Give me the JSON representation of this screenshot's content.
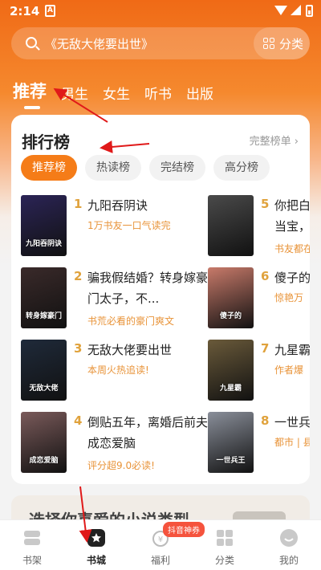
{
  "status_bar": {
    "time": "2:14",
    "sim_label": "A"
  },
  "search": {
    "placeholder": "《无敌大佬要出世》",
    "category_label": "分类",
    "search_icon": "search-icon",
    "grid_icon": "grid-icon"
  },
  "tabs": [
    {
      "label": "推荐",
      "active": true
    },
    {
      "label": "男生"
    },
    {
      "label": "女生"
    },
    {
      "label": "听书"
    },
    {
      "label": "出版"
    }
  ],
  "ranking": {
    "title": "排行榜",
    "more_label": "完整榜单 ›",
    "chips": [
      {
        "label": "推荐榜",
        "active": true
      },
      {
        "label": "热读榜"
      },
      {
        "label": "完结榜"
      },
      {
        "label": "高分榜"
      }
    ],
    "books": [
      {
        "rank": "1",
        "title": "九阳吞阴诀",
        "desc": "1万书友一口气读完",
        "cover_text": "九阳吞阴诀",
        "cover_color": "#2b2456"
      },
      {
        "rank": "2",
        "title": "骗我假结婚？转身嫁豪门太子，不...",
        "desc": "书荒必看的豪门爽文",
        "cover_text": "转身嫁豪门",
        "cover_color": "#3a2a2a"
      },
      {
        "rank": "3",
        "title": "无敌大佬要出世",
        "desc": "本周火热追读!",
        "cover_text": "无敌大佬",
        "cover_color": "#1f2a3a"
      },
      {
        "rank": "4",
        "title": "倒贴五年，离婚后前夫成恋爱脑",
        "desc": "评分超9.0必读!",
        "cover_text": "成恋爱脑",
        "cover_color": "#7a5a5a"
      },
      {
        "rank": "5",
        "title": "你把白月光当宝，我...",
        "desc": "书友都在",
        "cover_text": "",
        "cover_color": "#4a4a4a"
      },
      {
        "rank": "6",
        "title": "傻子的...",
        "desc": "惊艳万",
        "cover_text": "傻子的",
        "cover_color": "#c87a6a"
      },
      {
        "rank": "7",
        "title": "九星霸...",
        "desc": "作者爆",
        "cover_text": "九星霸",
        "cover_color": "#6a5a3a"
      },
      {
        "rank": "8",
        "title": "一世兵...",
        "desc": "都市 | 县",
        "cover_text": "一世兵王",
        "cover_color": "#8a8f9a"
      }
    ]
  },
  "promo": {
    "text": "选择你喜爱的小说类型"
  },
  "nav": [
    {
      "label": "书架",
      "icon": "bookshelf-icon"
    },
    {
      "label": "书城",
      "icon": "bookstore-icon",
      "active": true
    },
    {
      "label": "福利",
      "icon": "gift-icon"
    },
    {
      "label": "分类",
      "icon": "category-icon"
    },
    {
      "label": "我的",
      "icon": "profile-icon"
    }
  ],
  "badge": "抖音神券",
  "colors": {
    "accent": "#f57c18",
    "rank": "#e0a23c",
    "desc": "#e89338",
    "arrow": "#e01919"
  }
}
